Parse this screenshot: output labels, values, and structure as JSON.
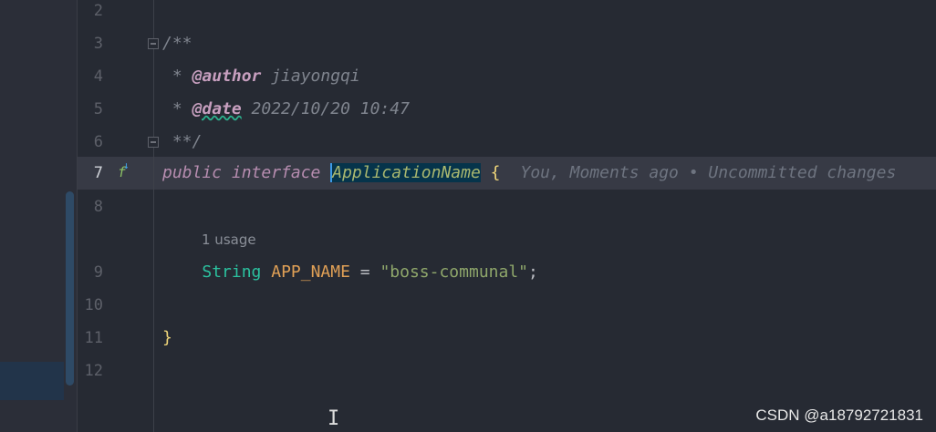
{
  "line_numbers": [
    "2",
    "3",
    "4",
    "5",
    "6",
    "7",
    "8",
    "9",
    "10",
    "11",
    "12"
  ],
  "code": {
    "l3": "/**",
    "l4_star": " * ",
    "l4_tag": "@author",
    "l4_val": " jiayongqi",
    "l5_star": " * ",
    "l5_tag": "@date",
    "l5_val": " 2022/10/20 10:47",
    "l6": " **/",
    "l7_kw": "public interface ",
    "l7_cls": "ApplicationName",
    "l7_brace": " {",
    "l7_hint": "You, Moments ago • Uncommitted changes",
    "usage": "1 usage",
    "l9_indent": "    ",
    "l9_type": "String",
    "l9_const": " APP_NAME",
    "l9_eq": " = ",
    "l9_str": "\"boss-communal\"",
    "l9_semi": ";",
    "l11": "}"
  },
  "gutter_icon": "fx-implementation-icon",
  "watermark": "CSDN @a18792721831"
}
